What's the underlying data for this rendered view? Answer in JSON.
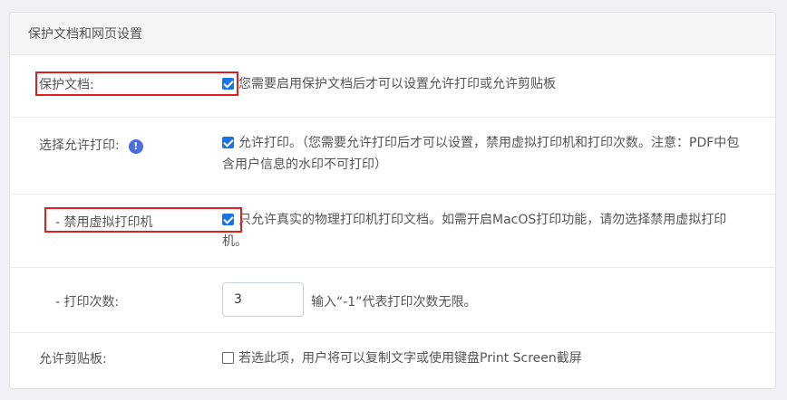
{
  "panel": {
    "title": "保护文档和网页设置"
  },
  "rows": {
    "protect_doc": {
      "label": "保护文档:",
      "checked": true,
      "text": "您需要启用保护文档后才可以设置允许打印或允许剪贴板"
    },
    "allow_print": {
      "label": "选择允许打印:",
      "info_icon": "info-icon",
      "checked": true,
      "text": "允许打印。（您需要允许打印后才可以设置，禁用虚拟打印机和打印次数。注意：PDF中包含用户信息的水印不可打印）"
    },
    "disable_virtual_printer": {
      "label": "- 禁用虚拟打印机",
      "checked": true,
      "text": "只允许真实的物理打印机打印文档。如需开启MacOS打印功能，请勿选择禁用虚拟打印机。"
    },
    "print_count": {
      "label": "- 打印次数:",
      "value": "3",
      "hint": "输入“-1”代表打印次数无限。"
    },
    "allow_clipboard": {
      "label": "允许剪贴板:",
      "checked": false,
      "text": "若选此项，用户将可以复制文字或使用键盘Print Screen截屏"
    }
  },
  "colors": {
    "accent": "#1a73e8",
    "highlight": "#e02020",
    "info": "#4a6ee0"
  }
}
